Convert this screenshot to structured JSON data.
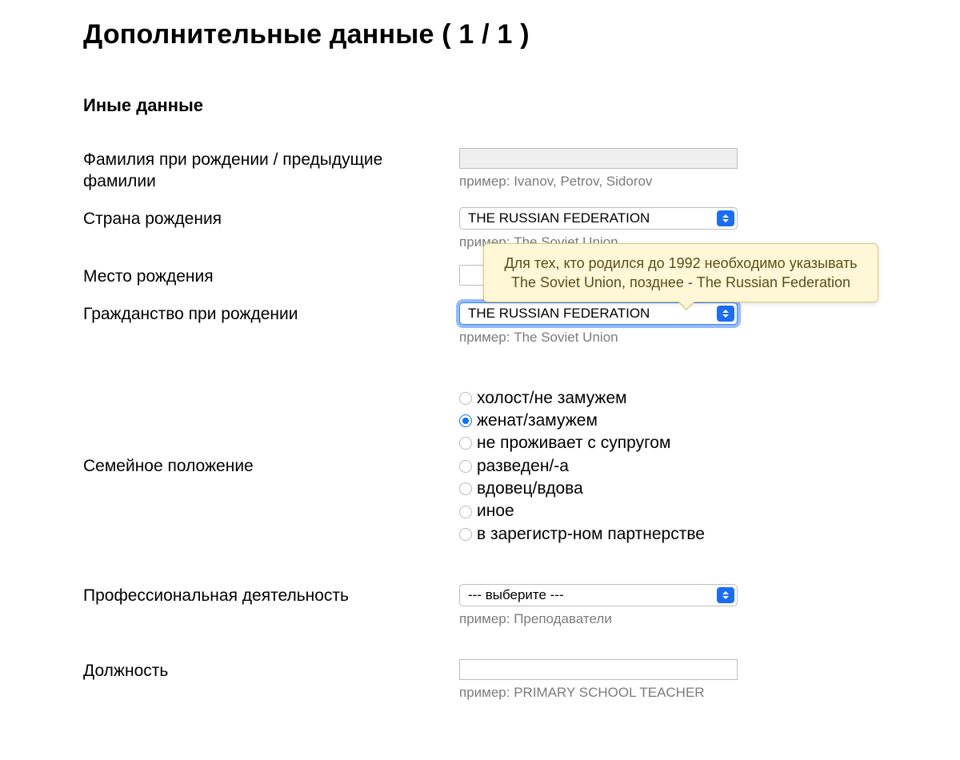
{
  "page_title": "Дополнительные данные ( 1 / 1 )",
  "section_title": "Иные данные",
  "fields": {
    "birth_surname": {
      "label": "Фамилия при рождении / предыдущие фамилии",
      "value": "",
      "hint": "пример: Ivanov, Petrov, Sidorov"
    },
    "birth_country": {
      "label": "Страна рождения",
      "value": "THE RUSSIAN FEDERATION",
      "hint": "пример: The Soviet Union"
    },
    "birth_place": {
      "label": "Место рождения",
      "value": ""
    },
    "birth_citizenship": {
      "label": "Гражданство при рождении",
      "value": "THE RUSSIAN FEDERATION",
      "hint": "пример: The Soviet Union",
      "tooltip": "Для тех, кто родился до 1992 необходимо указывать The Soviet Union, позднее - The Russian Federation"
    },
    "marital_status": {
      "label": "Семейное положение",
      "selected_index": 1,
      "options": [
        "холост/не замужем",
        "женат/замужем",
        "не проживает с супругом",
        "разведен/-а",
        "вдовец/вдова",
        "иное",
        "в зарегистр-ном партнерстве"
      ]
    },
    "profession": {
      "label": "Профессиональная деятельность",
      "value": "--- выберите ---",
      "hint": "пример: Преподаватели"
    },
    "position": {
      "label": "Должность",
      "value": "",
      "hint": "пример: PRIMARY SCHOOL TEACHER"
    }
  }
}
